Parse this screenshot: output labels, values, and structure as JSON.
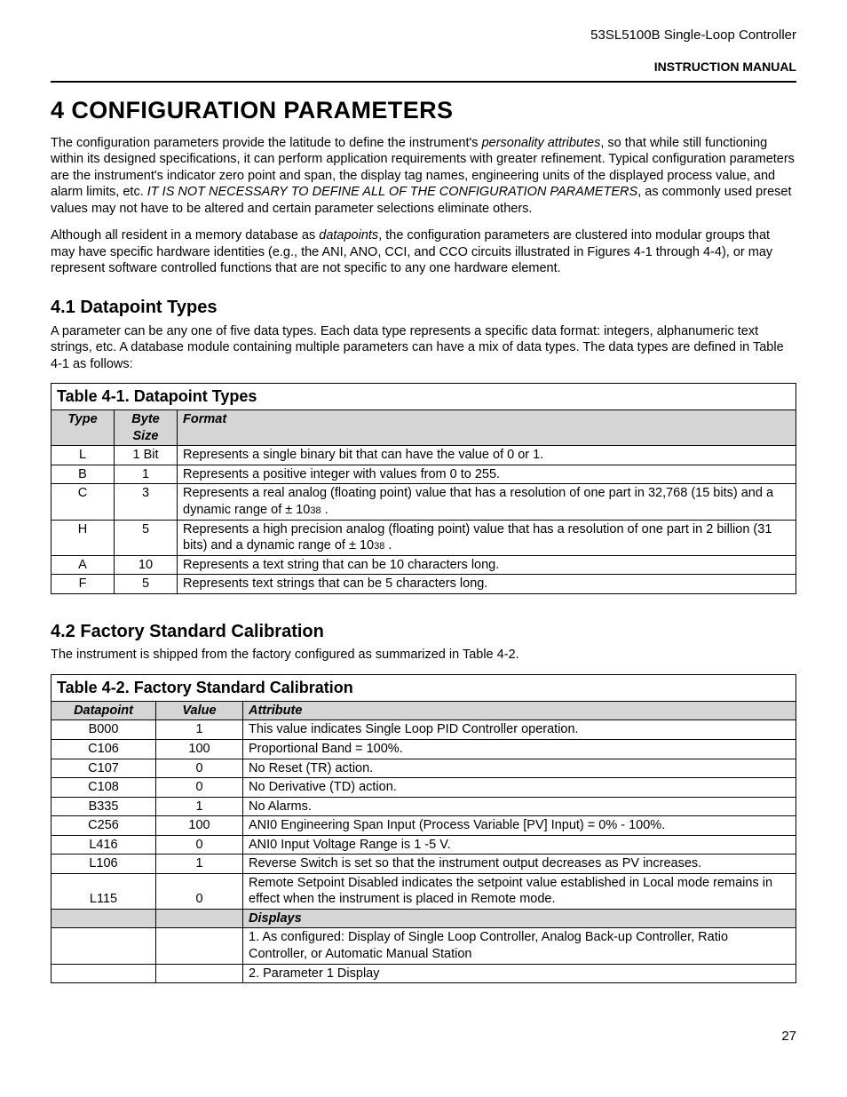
{
  "header": {
    "product": "53SL5100B Single-Loop Controller",
    "manual": "INSTRUCTION MANUAL"
  },
  "sectionTitle": "4  CONFIGURATION PARAMETERS",
  "para1a": "The configuration parameters provide the latitude to define the instrument's ",
  "para1_em1": "personality attributes",
  "para1b": ", so that while still functioning within its designed specifications, it can perform application requirements with greater refinement. Typical configuration parameters are the instrument's indicator zero point and span, the display tag names, engineering units of the displayed process value, and alarm limits, etc. ",
  "para1_em2": "IT IS NOT NECESSARY TO DEFINE ALL OF THE CONFIGURATION PARAMETERS",
  "para1c": ", as commonly used preset values may not have to be altered and certain parameter selections eliminate others.",
  "para2a": "Although all resident in a memory database as ",
  "para2_em": "datapoints",
  "para2b": ", the configuration parameters are clustered into modular groups that may have specific hardware identities (e.g., the ANI, ANO, CCI, and CCO circuits illustrated in Figures 4-1 through 4-4), or may represent software controlled functions that are not specific to any one hardware element.",
  "sec41": "4.1  Datapoint Types",
  "sec41_body": "A parameter can be any one of five data types. Each data type represents a specific data format: integers, alphanumeric text strings, etc. A database module containing multiple parameters can have a mix of data types. The data types are defined in Table 4-1 as follows:",
  "table41": {
    "caption": "Table 4-1. Datapoint Types",
    "headers": {
      "c1": "Type",
      "c2": "Byte Size",
      "c3": "Format"
    },
    "rows": [
      {
        "type": "L",
        "size": "1 Bit",
        "format": "Represents a single binary bit that can have the value of 0 or 1."
      },
      {
        "type": "B",
        "size": "1",
        "format": "Represents a positive integer with values from 0 to 255."
      },
      {
        "type": "C",
        "size": "3",
        "format": "Represents a real analog (floating point) value that has a resolution of one part in 32,768 (15 bits) and a dynamic range of ± 10",
        "sup": "38",
        "tail": " ."
      },
      {
        "type": "H",
        "size": "5",
        "format": "Represents a high precision analog (floating point) value that has a resolution of one part in 2 billion (31 bits) and a dynamic range of ± 10",
        "sup": "38",
        "tail": " ."
      },
      {
        "type": "A",
        "size": "10",
        "format": "Represents a text string that can be 10 characters long."
      },
      {
        "type": "F",
        "size": "5",
        "format": "Represents text strings that can be 5 characters long."
      }
    ]
  },
  "sec42": "4.2  Factory Standard Calibration",
  "sec42_body": "The instrument is shipped from the factory configured as summarized in Table 4-2.",
  "table42": {
    "caption": "Table 4-2. Factory Standard Calibration",
    "headers": {
      "c1": "Datapoint",
      "c2": "Value",
      "c3": "Attribute"
    },
    "rows": [
      {
        "dp": "B000",
        "val": "1",
        "attr": "This value indicates Single Loop PID Controller operation."
      },
      {
        "dp": "C106",
        "val": "100",
        "attr": "Proportional Band = 100%."
      },
      {
        "dp": "C107",
        "val": "0",
        "attr": "No Reset (TR) action."
      },
      {
        "dp": "C108",
        "val": "0",
        "attr": "No Derivative (TD) action."
      },
      {
        "dp": "B335",
        "val": "1",
        "attr": "No Alarms."
      },
      {
        "dp": "C256",
        "val": "100",
        "attr": "ANI0 Engineering Span Input (Process Variable [PV] Input) = 0% - 100%."
      },
      {
        "dp": "L416",
        "val": "0",
        "attr": "ANI0 Input Voltage Range is 1 -5 V."
      },
      {
        "dp": "L106",
        "val": "1",
        "attr": "Reverse Switch is set so that the instrument output decreases as PV increases."
      },
      {
        "dp": "L115",
        "val": "0",
        "attr": "Remote Setpoint Disabled indicates the setpoint value established in Local mode remains in effect when the instrument is placed in Remote mode."
      }
    ],
    "displaysHeader": "Displays",
    "displaysRow1": "1. As configured: Display of Single Loop Controller, Analog Back-up Controller, Ratio Controller, or Automatic Manual Station",
    "displaysRow2": "2. Parameter 1 Display"
  },
  "pageNumber": "27"
}
